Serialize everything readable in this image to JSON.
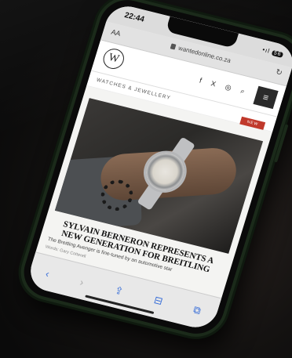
{
  "status": {
    "time": "22:44",
    "signal": "•ıl",
    "battery": "56"
  },
  "browser": {
    "aa_label": "AA",
    "url": "wantedonline.co.za",
    "reload": "↻"
  },
  "site": {
    "logo_letter": "W",
    "social": [
      "f",
      "X",
      "◎",
      "⌕"
    ],
    "menu": "≡",
    "section": "WATCHES & JEWELLERY",
    "badge": "NEW"
  },
  "article": {
    "headline": "Sylvain Berneron represents a new generation for Breitling",
    "dek": "The Breitling Avenger is fine-tuned by an automotive star",
    "byline": "Words: Gary Cotterell"
  },
  "toolbar": {
    "back": "‹",
    "forward": "›",
    "share": "⇪",
    "bookmarks": "⊟",
    "tabs": "⧉"
  }
}
